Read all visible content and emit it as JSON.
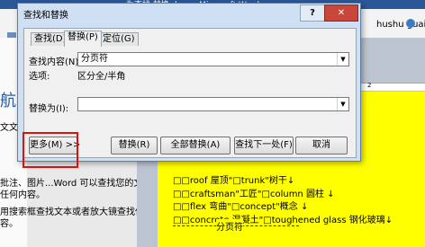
{
  "word": {
    "title_fragment": "为查找 替换.docx - Microsoft Word",
    "user_name": "hushu guai",
    "nav_title": "航",
    "left_fragments": [
      "文文",
      "批注、图片...Word 可以查找您的文档",
      "任何内容。",
      "用搜索框查找文本或者放大镜查找任何其",
      "容。"
    ],
    "ruler_mark": "2",
    "doc_lines": [
      "□□roof 屋顶\"□trunk\"树干↓",
      "□□craftsman\"工匠\"□column 圆柱 ↓",
      "□□flex 弯曲\"□concept\"概念 ↓",
      "□□concrete 混凝土\"□toughened glass 钢化玻璃↓"
    ],
    "page_break_label": "分页符"
  },
  "dialog": {
    "title": "查找和替换",
    "help_label": "?",
    "close_label": "✕",
    "tabs": [
      {
        "label": "查找(D)",
        "active": false
      },
      {
        "label": "替换(P)",
        "active": true
      },
      {
        "label": "定位(G)",
        "active": false
      }
    ],
    "find_label": "查找内容(N):",
    "find_value": "分页符",
    "options_label": "选项:",
    "options_value": "区分全/半角",
    "replace_label": "替换为(I):",
    "replace_value": "",
    "buttons": {
      "more": "更多(M) >>",
      "replace": "替换(R)",
      "replace_all": "全部替换(A)",
      "find_next": "查找下一处(F)",
      "cancel": "取消"
    }
  },
  "colors": {
    "highlight": "#ffff00",
    "callout_border": "#e01010",
    "close_button": "#c9473a"
  }
}
